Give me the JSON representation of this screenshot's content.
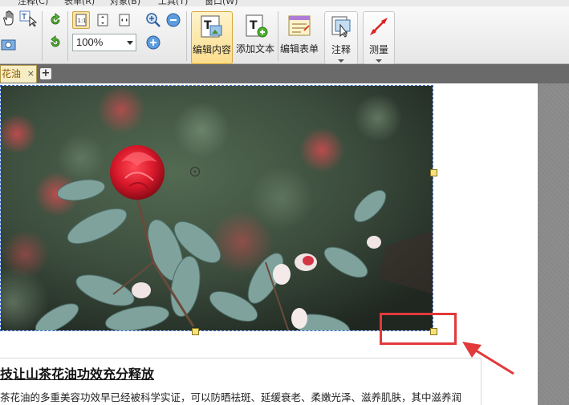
{
  "menubar": {
    "items": [
      "注释(C)",
      "表单(R)",
      "对象(B)",
      "工具(T)",
      "窗口(W)"
    ]
  },
  "toolbar": {
    "zoom_value": "100%",
    "buttons": {
      "edit_content": "编辑内容",
      "add_text": "添加文本",
      "edit_form": "编辑表单",
      "annotate": "注释",
      "measure": "测量"
    }
  },
  "tabs": {
    "active_label": "花油",
    "close_glyph": "×",
    "add_glyph": "+"
  },
  "document": {
    "headline": "技让山茶花油功效充分释放",
    "body": "茶花油的多重美容功效早已经被科学实证，可以防晒祛斑、延缓衰老、柔嫩光泽、滋养肌肤，其中滋养润"
  },
  "colors": {
    "annotation_red": "#e2393a",
    "selection_blue": "#3a6fd0",
    "tab_bg": "#f7edc4",
    "active_button": "#fbdd8c"
  }
}
